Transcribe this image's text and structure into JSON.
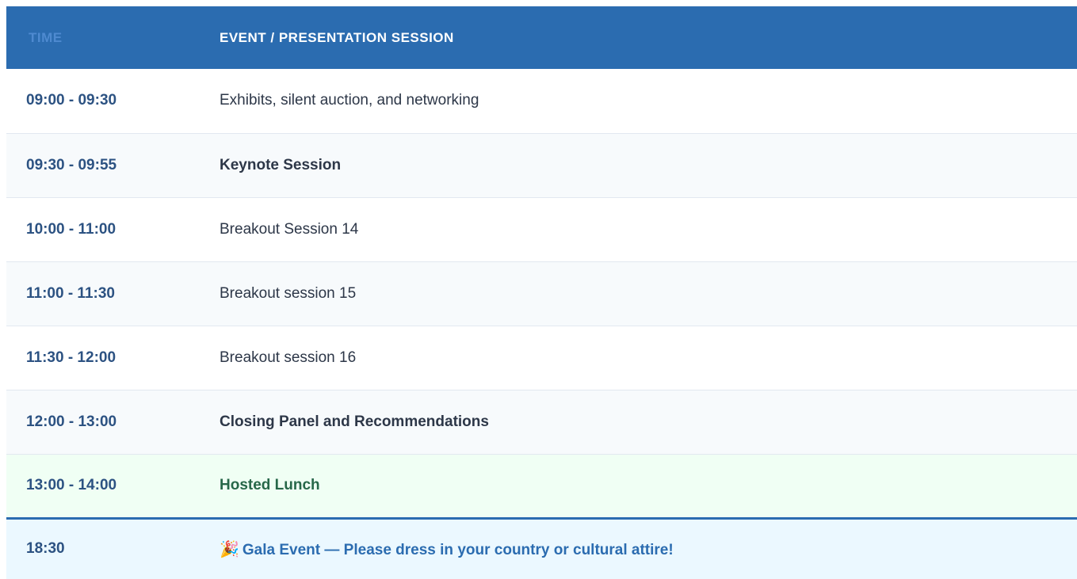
{
  "header": {
    "time_label": "TIME",
    "event_label": "EVENT / PRESENTATION SESSION"
  },
  "rows": [
    {
      "time": "09:00 - 09:30",
      "event": "Exhibits, silent auction, and networking"
    },
    {
      "time": "09:30 - 09:55",
      "event": "Keynote Session"
    },
    {
      "time": "10:00 - 11:00",
      "event": "Breakout Session 14"
    },
    {
      "time": "11:00 - 11:30",
      "event": "Breakout session 15"
    },
    {
      "time": "11:30 - 12:00",
      "event": "Breakout session 16"
    },
    {
      "time": "12:00 - 13:00",
      "event": "Closing Panel and Recommendations"
    },
    {
      "time": "13:00 - 14:00",
      "event": "Hosted Lunch"
    },
    {
      "time": "18:30",
      "event": "Gala Event — Please dress in your country or cultural attire!",
      "icon": "🎉"
    }
  ],
  "colors": {
    "header_bg": "#2b6cb0",
    "time_text": "#2c5282",
    "lunch_bg": "#f0fff4",
    "lunch_text": "#276749",
    "gala_bg": "#ebf8ff",
    "gala_text": "#2b6cb0"
  },
  "icons": {
    "gala": "party-popper-icon"
  }
}
